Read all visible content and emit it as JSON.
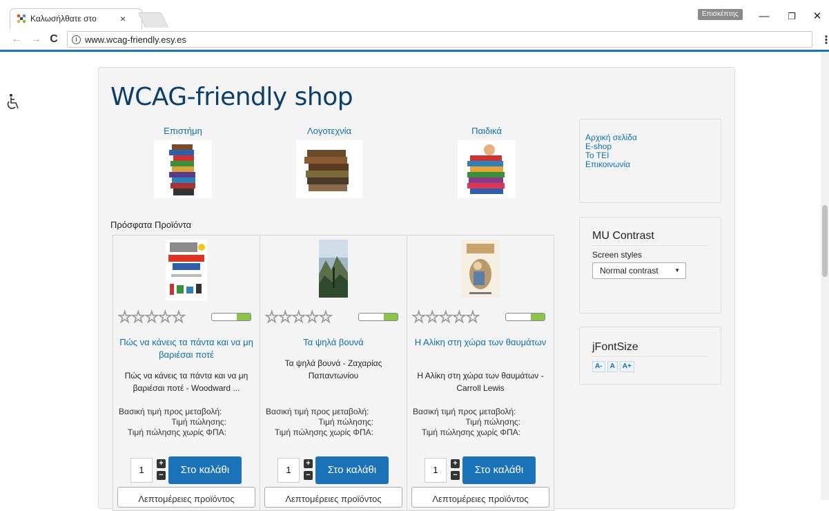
{
  "browser": {
    "tab_title": "Καλωσήλθατε στο",
    "tab_close": "×",
    "profile_badge": "Επισκέπτης",
    "minimize": "—",
    "restore": "❐",
    "close": "✕",
    "back": "←",
    "forward": "→",
    "reload": "C",
    "info": "i",
    "url": "www.wcag-friendly.esy.es",
    "menu": "⋮"
  },
  "site": {
    "title": "WCAG-friendly shop",
    "categories": [
      {
        "label": "Επιστήμη"
      },
      {
        "label": "Λογοτεχνία"
      },
      {
        "label": "Παιδικά"
      }
    ],
    "recent_label": "Πρόσφατα Προϊόντα"
  },
  "products": [
    {
      "name": "Πώς να κάνεις τα πάντα και να μη βαριέσαι ποτέ",
      "desc": "Πώς να κάνεις τα πάντα και να μη βαριέσαι ποτέ - Woodward ...",
      "stars": "☆☆☆☆☆",
      "stock_fraction": 0.35,
      "qty": "1",
      "cart": "Στο καλάθι",
      "details": "Λεπτομέρειες προϊόντος"
    },
    {
      "name": "Τα ψηλά βουνά",
      "desc": "Τα ψηλά βουνά - Ζαχαρίας Παπαντωνίου",
      "stars": "☆☆☆☆☆",
      "stock_fraction": 0.35,
      "qty": "1",
      "cart": "Στο καλάθι",
      "details": "Λεπτομέρειες προϊόντος"
    },
    {
      "name": "Η Αλίκη στη χώρα των θαυμάτων",
      "desc": "Η Αλίκη στη χώρα των θαυμάτων - Carroll Lewis",
      "stars": "☆☆☆☆☆",
      "stock_fraction": 0.35,
      "qty": "1",
      "cart": "Στο καλάθι",
      "details": "Λεπτομέρειες προϊόντος"
    }
  ],
  "price_labels": {
    "base": "Βασική τιμή προς μεταβολή:",
    "sale": "Τιμή πώλησης:",
    "net": "Τιμή πώλησης χωρίς ΦΠΑ:"
  },
  "stepper": {
    "plus": "+",
    "minus": "−"
  },
  "menu": {
    "items": [
      "Αρχική σελίδα",
      "E-shop",
      "Το ΤΕΙ",
      "Επικοινωνία"
    ]
  },
  "contrast": {
    "title": "MU Contrast",
    "label": "Screen styles",
    "selected": "Normal contrast"
  },
  "fontsize": {
    "title": "jFontSize",
    "buttons": [
      "A-",
      "A",
      "A+"
    ]
  },
  "colors": {
    "accent": "#1a73b8",
    "link": "#0b6fb0",
    "title": "#0b3f6a",
    "stock_green": "#8bc34a"
  }
}
